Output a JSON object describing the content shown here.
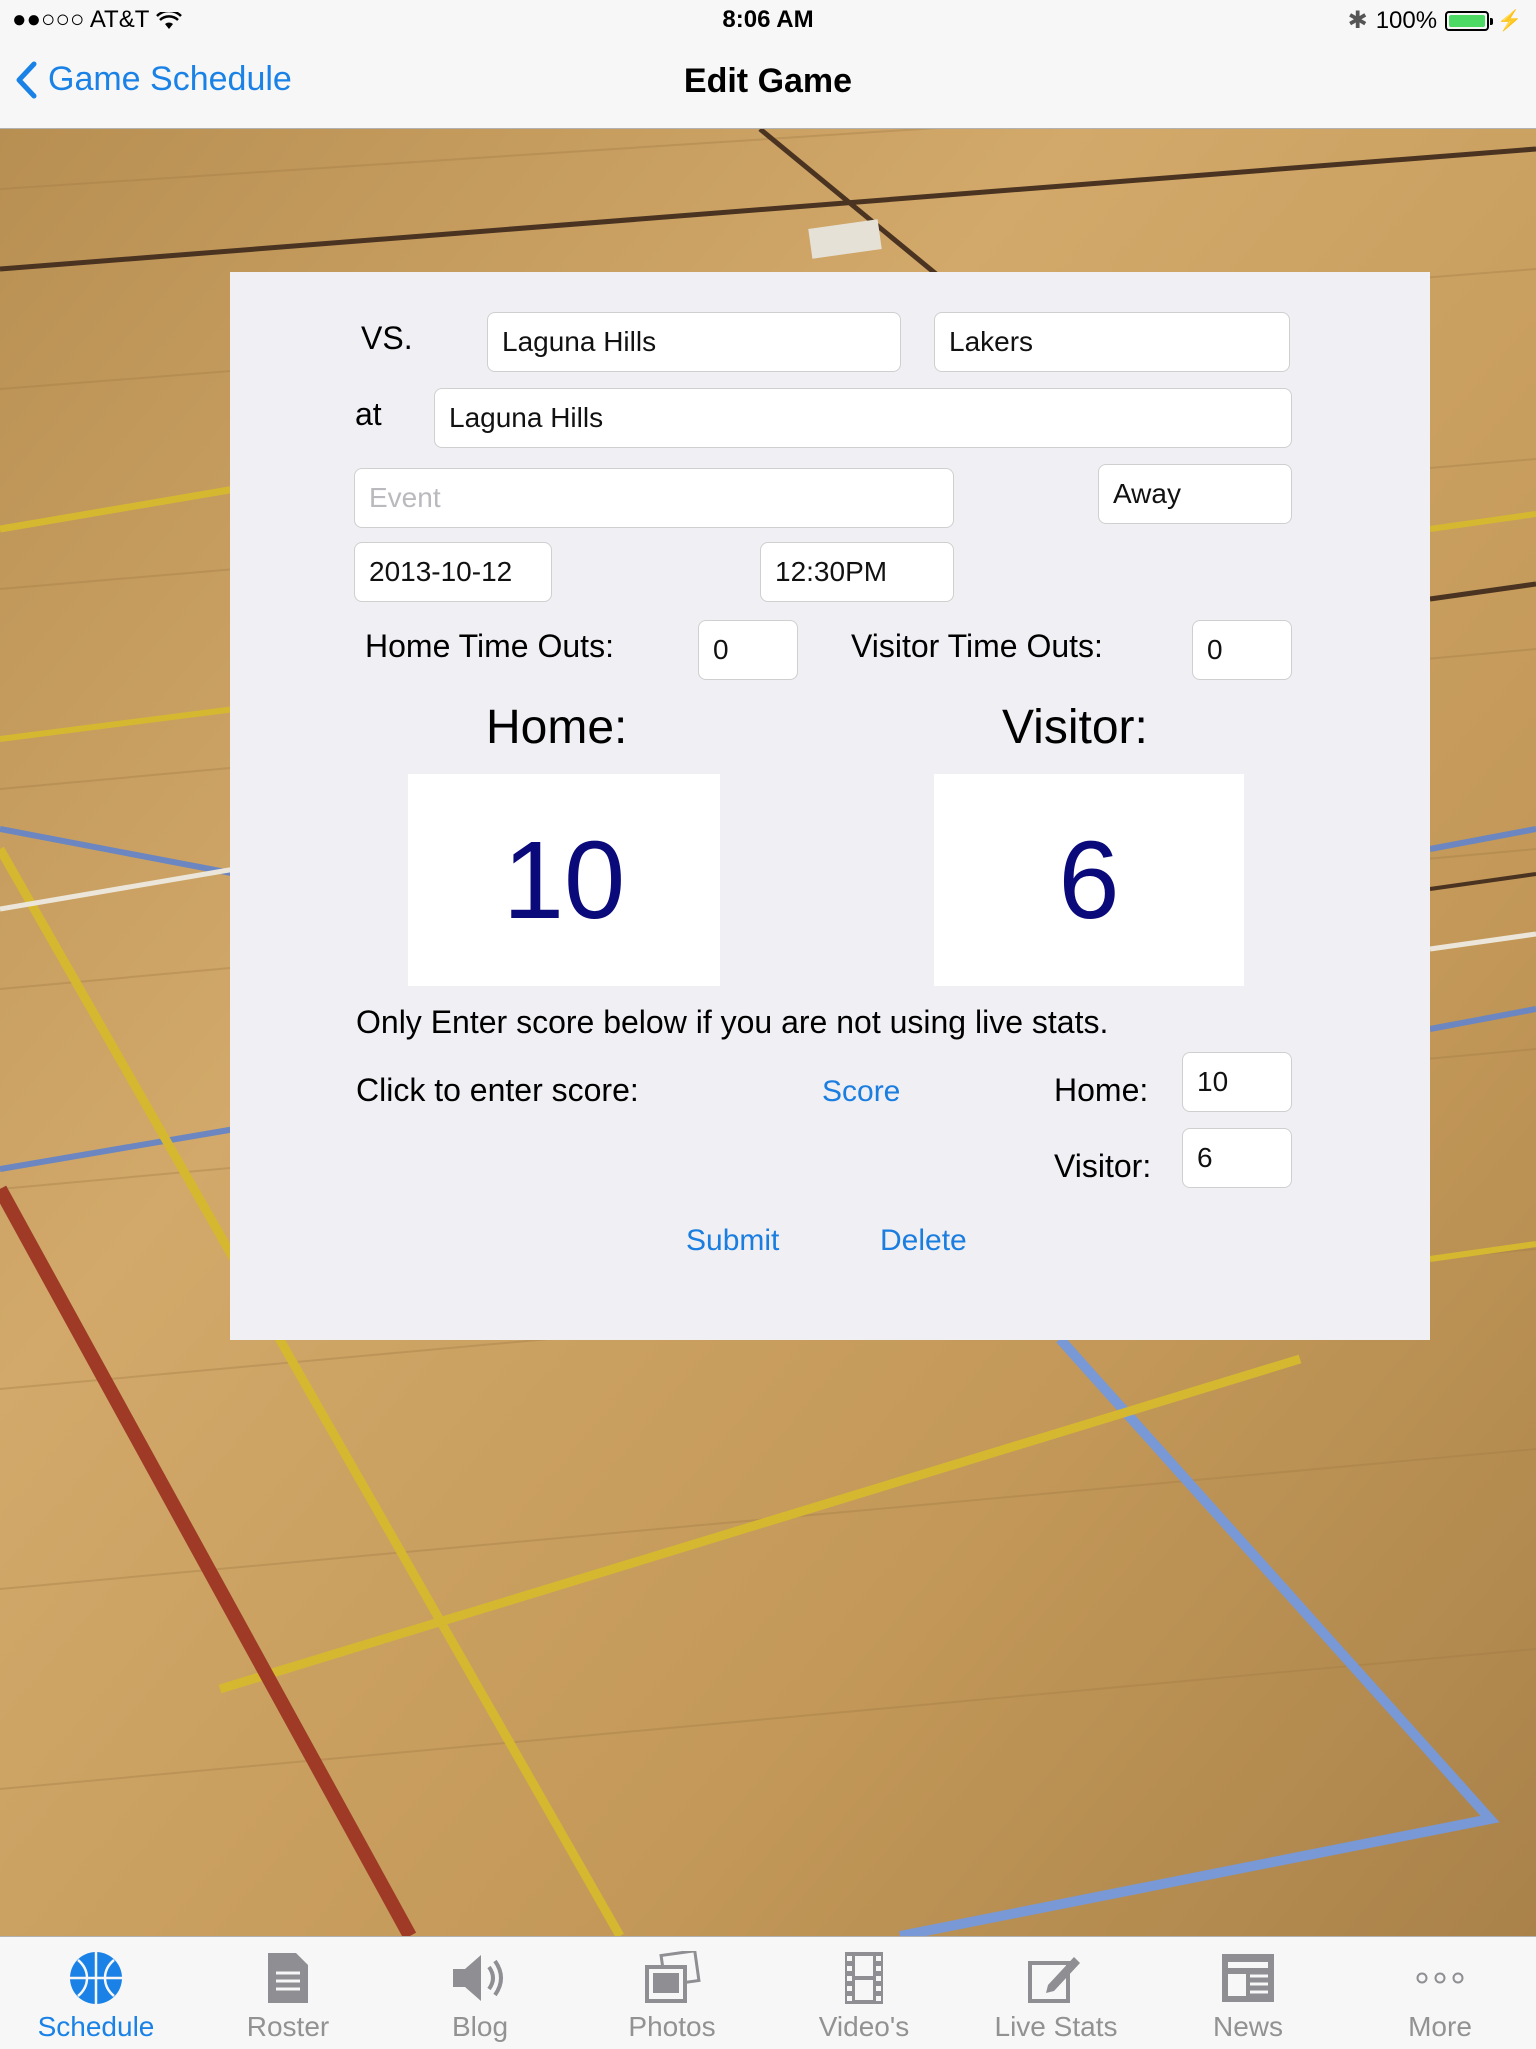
{
  "status": {
    "carrier": "●●○○○ AT&T",
    "time": "8:06 AM",
    "battery": "100%"
  },
  "nav": {
    "back_label": "Game Schedule",
    "title": "Edit Game"
  },
  "form": {
    "vs_label": "VS.",
    "opponent_city": "Laguna Hills",
    "opponent_team": "Lakers",
    "at_label": "at",
    "location": "Laguna Hills",
    "event_placeholder": "Event",
    "home_away": "Away",
    "date": "2013-10-12",
    "time": "12:30PM",
    "home_timeouts_label": "Home Time Outs:",
    "home_timeouts": "0",
    "visitor_timeouts_label": "Visitor Time Outs:",
    "visitor_timeouts": "0"
  },
  "scoreboard": {
    "home_label": "Home:",
    "visitor_label": "Visitor:",
    "home_score": "10",
    "visitor_score": "6"
  },
  "manual_score": {
    "note": "Only Enter score below if you are not using live stats.",
    "click_label": "Click to enter score:",
    "score_link": "Score",
    "home_label": "Home:",
    "home_value": "10",
    "visitor_label": "Visitor:",
    "visitor_value": "6"
  },
  "actions": {
    "submit": "Submit",
    "delete": "Delete"
  },
  "tabs": [
    {
      "label": "Schedule",
      "icon": "basketball-icon",
      "active": true
    },
    {
      "label": "Roster",
      "icon": "document-icon",
      "active": false
    },
    {
      "label": "Blog",
      "icon": "speaker-icon",
      "active": false
    },
    {
      "label": "Photos",
      "icon": "photos-icon",
      "active": false
    },
    {
      "label": "Video's",
      "icon": "film-icon",
      "active": false
    },
    {
      "label": "Live Stats",
      "icon": "edit-icon",
      "active": false
    },
    {
      "label": "News",
      "icon": "newspaper-icon",
      "active": false
    },
    {
      "label": "More",
      "icon": "more-icon",
      "active": false
    }
  ],
  "colors": {
    "accent": "#1a82e6",
    "score_text": "#0a0a7a",
    "card_bg": "#efeff4",
    "floor": "#c8a063"
  }
}
